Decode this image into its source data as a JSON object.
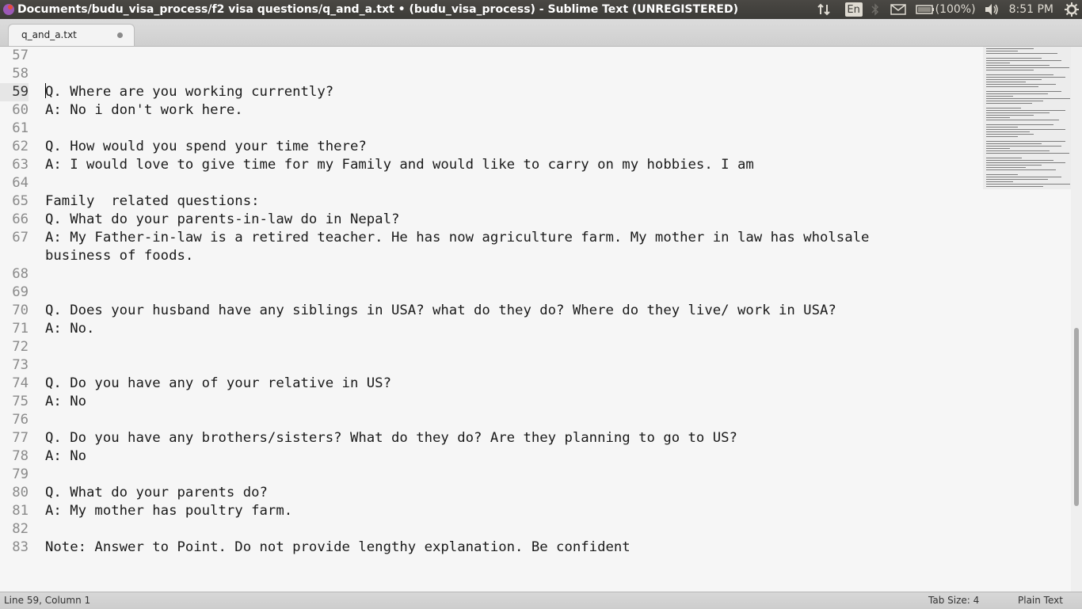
{
  "window": {
    "title": "Documents/budu_visa_process/f2 visa questions/q_and_a.txt • (budu_visa_process) - Sublime Text (UNREGISTERED)"
  },
  "indicators": {
    "keyboard_layout": "En",
    "battery": "(100%)",
    "time": "8:51 PM"
  },
  "tab": {
    "label": "q_and_a.txt"
  },
  "editor": {
    "lines": [
      {
        "num": "57",
        "text": ""
      },
      {
        "num": "58",
        "text": ""
      },
      {
        "num": "59",
        "text": "Q. Where are you working currently?"
      },
      {
        "num": "60",
        "text": "A: No i don't work here."
      },
      {
        "num": "61",
        "text": ""
      },
      {
        "num": "62",
        "text": "Q. How would you spend your time there?"
      },
      {
        "num": "63",
        "text": "A: I would love to give time for my Family and would like to carry on my hobbies. I am"
      },
      {
        "num": "64",
        "text": ""
      },
      {
        "num": "65",
        "text": "Family  related questions:"
      },
      {
        "num": "66",
        "text": "Q. What do your parents-in-law do in Nepal?"
      },
      {
        "num": "67",
        "text": "A: My Father-in-law is a retired teacher. He has now agriculture farm. My mother in law has wholsale business of foods."
      },
      {
        "num": "68",
        "text": ""
      },
      {
        "num": "69",
        "text": ""
      },
      {
        "num": "70",
        "text": "Q. Does your husband have any siblings in USA? what do they do? Where do they live/ work in USA?"
      },
      {
        "num": "71",
        "text": "A: No."
      },
      {
        "num": "72",
        "text": ""
      },
      {
        "num": "73",
        "text": ""
      },
      {
        "num": "74",
        "text": "Q. Do you have any of your relative in US?"
      },
      {
        "num": "75",
        "text": "A: No"
      },
      {
        "num": "76",
        "text": ""
      },
      {
        "num": "77",
        "text": "Q. Do you have any brothers/sisters? What do they do? Are they planning to go to US?"
      },
      {
        "num": "78",
        "text": "A: No"
      },
      {
        "num": "79",
        "text": ""
      },
      {
        "num": "80",
        "text": "Q. What do your parents do?"
      },
      {
        "num": "81",
        "text": "A: My mother has poultry farm."
      },
      {
        "num": "82",
        "text": ""
      },
      {
        "num": "83",
        "text": "Note: Answer to Point. Do not provide lengthy explanation. Be confident"
      }
    ]
  },
  "status": {
    "position": "Line 59, Column 1",
    "tab_size": "Tab Size: 4",
    "syntax": "Plain Text"
  },
  "colors": {
    "panel": "#3c3b37",
    "editor_bg": "#f6f6f6",
    "text": "#1a1a1a",
    "gutter_text": "#8a8a8a"
  }
}
